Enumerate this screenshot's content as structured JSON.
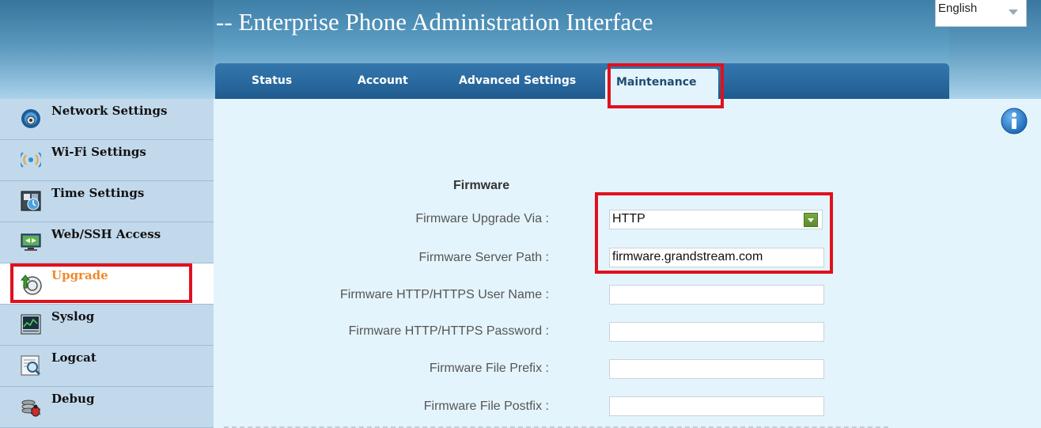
{
  "header": {
    "title": "-- Enterprise Phone Administration Interface",
    "language": "English"
  },
  "tabs": [
    {
      "label": "Status",
      "active": false
    },
    {
      "label": "Account",
      "active": false
    },
    {
      "label": "Advanced Settings",
      "active": false
    },
    {
      "label": "Maintenance",
      "active": true
    }
  ],
  "sidebar": {
    "items": [
      {
        "label": "Network Settings",
        "icon": "network-globe-icon"
      },
      {
        "label": "Wi-Fi Settings",
        "icon": "wifi-icon"
      },
      {
        "label": "Time Settings",
        "icon": "clock-icon"
      },
      {
        "label": "Web/SSH Access",
        "icon": "monitor-icon"
      },
      {
        "label": "Upgrade",
        "icon": "upgrade-arrow-icon",
        "active": true
      },
      {
        "label": "Syslog",
        "icon": "syslog-chart-icon"
      },
      {
        "label": "Logcat",
        "icon": "magnifier-icon"
      },
      {
        "label": "Debug",
        "icon": "bug-icon"
      }
    ]
  },
  "firmware": {
    "section_title": "Firmware",
    "upgrade_via_label": "Firmware Upgrade Via :",
    "upgrade_via_value": "HTTP",
    "server_path_label": "Firmware Server Path :",
    "server_path_value": "firmware.grandstream.com",
    "username_label": "Firmware HTTP/HTTPS User Name :",
    "username_value": "",
    "password_label": "Firmware HTTP/HTTPS Password :",
    "password_value": "",
    "prefix_label": "Firmware File Prefix :",
    "prefix_value": "",
    "postfix_label": "Firmware File Postfix :",
    "postfix_value": ""
  },
  "colors": {
    "active_sidebar_text": "#f1892b",
    "highlight_border": "#e0101e",
    "tab_bar": "#2a6aa0",
    "content_bg": "#e4f4fc"
  }
}
